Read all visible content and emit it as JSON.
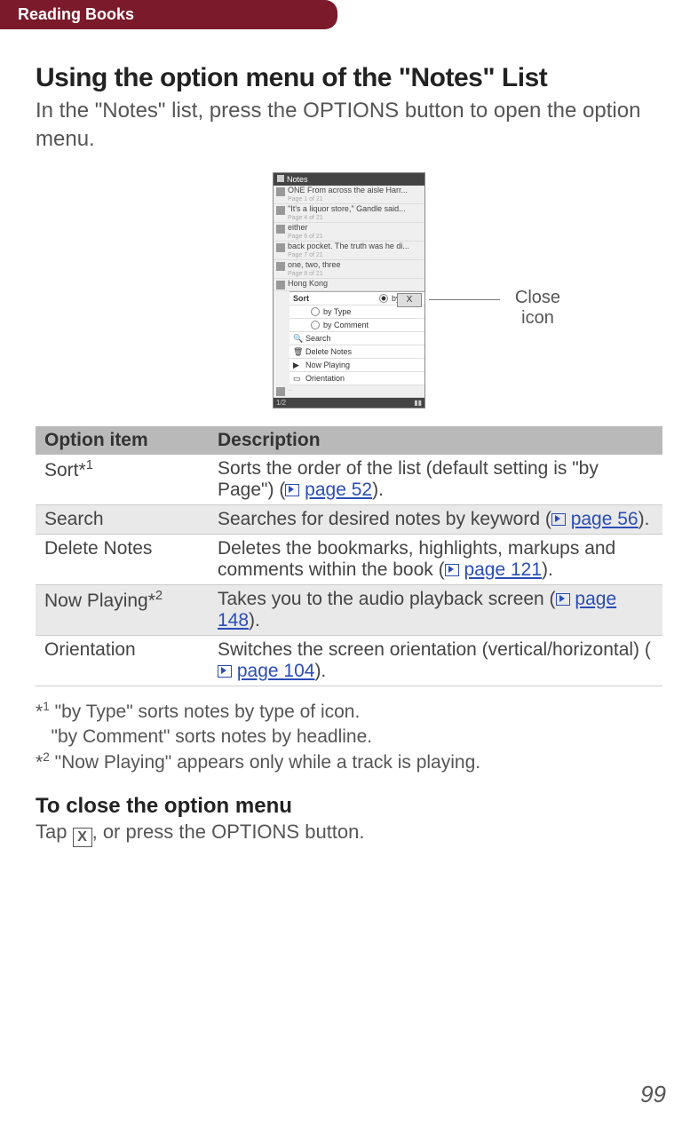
{
  "header": {
    "section": "Reading Books"
  },
  "title": "Using the option menu of the \"Notes\" List",
  "intro": "In the \"Notes\" list, press the OPTIONS button to open the option menu.",
  "figure": {
    "device_title_left": "Notes",
    "device_title_right": "",
    "notes": [
      {
        "text": "ONE From across the aisle Harr...",
        "sub": "Page 1 of 21"
      },
      {
        "text": "\"It's a liquor store,\" Gandle said...",
        "sub": "Page 4 of 21"
      },
      {
        "text": "either",
        "sub": "Page 6 of 21"
      },
      {
        "text": "back pocket. The truth was he di...",
        "sub": "Page 7 of 21"
      },
      {
        "text": "one, two, three",
        "sub": "Page 8 of 21"
      },
      {
        "text": "Hong Kong",
        "sub": ""
      }
    ],
    "popup": {
      "sort_label": "Sort",
      "option_page": "by Page",
      "option_type": "by Type",
      "option_comment": "by Comment",
      "search": "Search",
      "delete": "Delete Notes",
      "now_playing": "Now Playing",
      "orientation": "Orientation",
      "close_x": "X"
    },
    "footer_left": "1/2",
    "callout": "Close icon"
  },
  "table": {
    "head_option": "Option item",
    "head_desc": "Description",
    "rows": [
      {
        "name_pre": "Sort*",
        "name_sup": "1",
        "desc_pre": "Sorts the order of the list (default setting is \"by Page\") (",
        "link": "page 52",
        "desc_post": ")."
      },
      {
        "name_pre": "Search",
        "name_sup": "",
        "desc_pre": "Searches for desired notes by keyword (",
        "link": "page 56",
        "desc_post": ")."
      },
      {
        "name_pre": "Delete Notes",
        "name_sup": "",
        "desc_pre": "Deletes the bookmarks, highlights, markups and comments within the book (",
        "link": "page 121",
        "desc_post": ")."
      },
      {
        "name_pre": "Now Playing*",
        "name_sup": "2",
        "desc_pre": "Takes you to the audio playback screen (",
        "link": "page 148",
        "desc_post": ")."
      },
      {
        "name_pre": "Orientation",
        "name_sup": "",
        "desc_pre": "Switches the screen orientation (vertical/horizontal) (",
        "link": "page 104",
        "desc_post": ")."
      }
    ]
  },
  "footnotes": {
    "f1_sup": "1",
    "f1_pre": "*",
    "f1_line1": "\"by Type\" sorts notes by type of icon.",
    "f1_line2": "\"by Comment\" sorts notes by headline.",
    "f2_sup": "2",
    "f2_pre": "*",
    "f2_text": "\"Now Playing\" appears only while a track is playing."
  },
  "close_section": {
    "heading": "To close the option menu",
    "pre": "Tap ",
    "x": "X",
    "post": ", or press the OPTIONS button."
  },
  "page_number": "99"
}
